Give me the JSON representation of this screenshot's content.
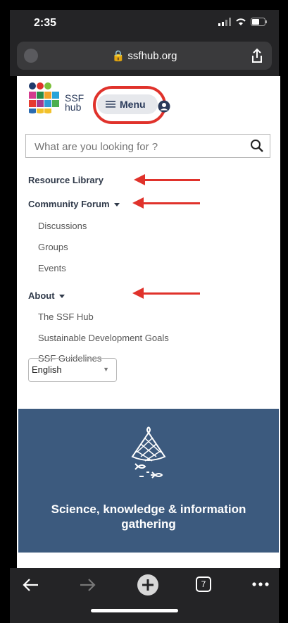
{
  "status_bar": {
    "time": "2:35"
  },
  "browser": {
    "url": "ssfhub.org"
  },
  "header": {
    "logo_line1": "SSF",
    "logo_line2": "hub",
    "menu_label": "Menu"
  },
  "search": {
    "placeholder": "What are you looking for ?"
  },
  "nav": {
    "resource_library": "Resource Library",
    "community_forum": "Community Forum",
    "community_sub": [
      "Discussions",
      "Groups",
      "Events"
    ],
    "about": "About",
    "about_sub": [
      "The SSF Hub",
      "Sustainable Development Goals",
      "SSF Guidelines"
    ]
  },
  "language_select": {
    "value": "English"
  },
  "card": {
    "title_line1": "Science, knowledge & information",
    "title_line2": "gathering"
  },
  "tabs_count": "7",
  "colors": {
    "accent_red": "#e0322b",
    "card_blue": "#3c5a7e",
    "browser_chrome": "#242426"
  }
}
